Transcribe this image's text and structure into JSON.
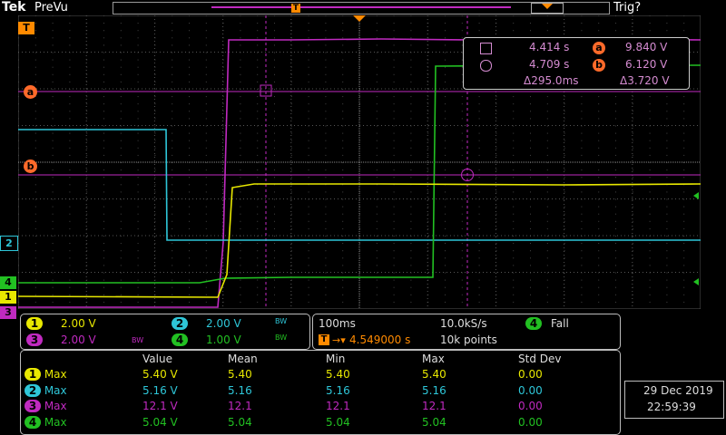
{
  "header": {
    "brand": "Tek",
    "mode": "PreVu",
    "trigger_status": "Trig?"
  },
  "channels": [
    {
      "id": "1",
      "color": "#e8e800",
      "scale": "2.00 V"
    },
    {
      "id": "2",
      "color": "#2ec6d8",
      "scale": "2.00 V",
      "bw": "BW"
    },
    {
      "id": "3",
      "color": "#c02ac0",
      "scale": "2.00 V",
      "bw": "BW"
    },
    {
      "id": "4",
      "color": "#22c022",
      "scale": "1.00 V",
      "bw": "BW"
    }
  ],
  "markers": {
    "trigger": "T",
    "ref_a": "a",
    "ref_b": "b"
  },
  "cursor_readout": {
    "t1": "4.414 s",
    "t2": "4.709 s",
    "dt": "Δ295.0ms",
    "va": "9.840 V",
    "vb": "6.120 V",
    "dv": "Δ3.720 V"
  },
  "timebase": {
    "scale": "100ms",
    "rate": "10.0kS/s",
    "trigger_channel": "4",
    "trigger_slope": "Fall",
    "position": "4.549000 s",
    "record": "10k points"
  },
  "measurements": {
    "headers": [
      "Value",
      "Mean",
      "Min",
      "Max",
      "Std Dev"
    ],
    "rows": [
      {
        "ch": "1",
        "type": "Max",
        "value": "5.40 V",
        "mean": "5.40",
        "min": "5.40",
        "max": "5.40",
        "std": "0.00",
        "color": "#e8e800"
      },
      {
        "ch": "2",
        "type": "Max",
        "value": "5.16 V",
        "mean": "5.16",
        "min": "5.16",
        "max": "5.16",
        "std": "0.00",
        "color": "#2ec6d8"
      },
      {
        "ch": "3",
        "type": "Max",
        "value": "12.1 V",
        "mean": "12.1",
        "min": "12.1",
        "max": "12.1",
        "std": "0.00",
        "color": "#c02ac0"
      },
      {
        "ch": "4",
        "type": "Max",
        "value": "5.04 V",
        "mean": "5.04",
        "min": "5.04",
        "max": "5.04",
        "std": "0.00",
        "color": "#22c022"
      }
    ]
  },
  "datetime": {
    "date": "29 Dec  2019",
    "time": "22:59:39"
  }
}
